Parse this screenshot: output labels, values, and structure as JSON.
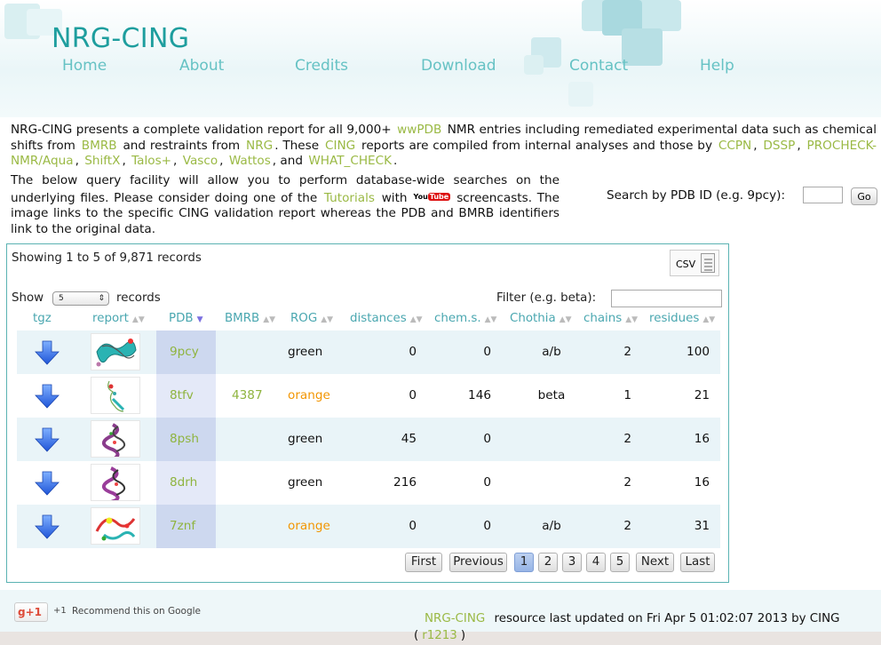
{
  "site": {
    "title": "NRG-CING"
  },
  "nav": [
    {
      "label": "Home"
    },
    {
      "label": "About"
    },
    {
      "label": "Credits"
    },
    {
      "label": "Download"
    },
    {
      "label": "Contact"
    },
    {
      "label": "Help"
    }
  ],
  "intro": {
    "p1_a": "NRG-CING presents a complete validation report for all 9,000+",
    "link_wwpdb": "wwPDB",
    "p1_b": "NMR entries including remediated experimental data such as chemical shifts from",
    "link_bmrb": "BMRB",
    "p1_c": "and restraints from",
    "link_nrg": "NRG",
    "p1_d": ". These",
    "link_cing": "CING",
    "p1_e": "reports are compiled from internal analyses and those by",
    "link_ccpn": "CCPN",
    "sep": ",",
    "link_dssp": "DSSP",
    "link_procheck": "PROCHECK-NMR/Aqua",
    "link_shiftx": "ShiftX",
    "link_talos": "Talos+",
    "link_vasco": "Vasco",
    "link_wattos": "Wattos",
    "and": ", and",
    "link_whatcheck": "WHAT_CHECK",
    "end": ".",
    "p2_a": "The below query facility will allow you to perform database-wide searches on the underlying files. Please consider doing one of the",
    "link_tutorials": "Tutorials",
    "p2_b": "with",
    "youtube_you": "You",
    "youtube_tube": "Tube",
    "p2_c": "screencasts. The image links to the specific CING validation report whereas the PDB and BMRB identifiers link to the original data."
  },
  "search": {
    "label": "Search by PDB ID (e.g. 9pcy):",
    "value": "",
    "go_label": "Go"
  },
  "table_controls": {
    "showing": "Showing 1 to 5 of 9,871 records",
    "csv_label": "CSV",
    "show_label": "Show",
    "length_value": "5",
    "records_label": "records",
    "filter_label": "Filter (e.g. beta):",
    "filter_value": ""
  },
  "columns": [
    "tgz",
    "report",
    "PDB",
    "BMRB",
    "ROG",
    "distances",
    "chem.s.",
    "Chothia",
    "chains",
    "residues"
  ],
  "sort_icons": {
    "both": "▲▼",
    "desc": "▼"
  },
  "rows": [
    {
      "pdb": "9pcy",
      "bmrb": "",
      "rog": "green",
      "distances": "0",
      "chems": "0",
      "chothia": "a/b",
      "chains": "2",
      "residues": "100"
    },
    {
      "pdb": "8tfv",
      "bmrb": "4387",
      "rog": "orange",
      "distances": "0",
      "chems": "146",
      "chothia": "beta",
      "chains": "1",
      "residues": "21"
    },
    {
      "pdb": "8psh",
      "bmrb": "",
      "rog": "green",
      "distances": "45",
      "chems": "0",
      "chothia": "",
      "chains": "2",
      "residues": "16"
    },
    {
      "pdb": "8drh",
      "bmrb": "",
      "rog": "green",
      "distances": "216",
      "chems": "0",
      "chothia": "",
      "chains": "2",
      "residues": "16"
    },
    {
      "pdb": "7znf",
      "bmrb": "",
      "rog": "orange",
      "distances": "0",
      "chems": "0",
      "chothia": "a/b",
      "chains": "2",
      "residues": "31"
    }
  ],
  "pager": {
    "first": "First",
    "previous": "Previous",
    "pages": [
      "1",
      "2",
      "3",
      "4",
      "5"
    ],
    "current": "1",
    "next": "Next",
    "last": "Last"
  },
  "footer": {
    "gplus_label": "+1",
    "gplus_count": "+1",
    "gplus_text": "Recommend this on Google",
    "site_link": "NRG-CING",
    "updated_text": "resource last updated on Fri Apr 5 01:02:07 2013 by CING",
    "rev_open": "(",
    "revision": "r1213",
    "rev_close": ")"
  },
  "colors": {
    "accent": "#1e9e9e",
    "link": "#8fb43f",
    "orange": "#f29500",
    "pdb_column": "#cdd8ef",
    "row_stripe": "#e9f4f8"
  }
}
